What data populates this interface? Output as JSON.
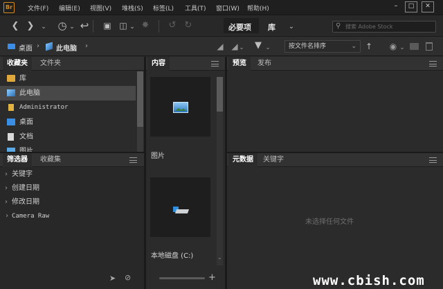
{
  "app": {
    "logo": "Br"
  },
  "menubar": {
    "items": [
      "文件(F)",
      "编辑(E)",
      "视图(V)",
      "堆栈(S)",
      "标签(L)",
      "工具(T)",
      "窗口(W)",
      "帮助(H)"
    ]
  },
  "window": {
    "minimize": "–",
    "maximize": "□",
    "close": "✕"
  },
  "toolbar": {
    "workspaces": [
      "必要项",
      "库"
    ],
    "search_placeholder": "搜索 Adobe Stock"
  },
  "path": {
    "crumbs": [
      "桌面",
      "此电脑"
    ],
    "sort_label": "按文件名排序"
  },
  "favorites_panel": {
    "tabs": [
      "收藏夹",
      "文件夹"
    ],
    "items": [
      {
        "label": "库",
        "icon": "library-icon"
      },
      {
        "label": "此电脑",
        "icon": "computer-icon"
      },
      {
        "label": "Administrator",
        "icon": "user-folder-icon"
      },
      {
        "label": "桌面",
        "icon": "desktop-icon"
      },
      {
        "label": "文档",
        "icon": "document-icon"
      },
      {
        "label": "图片",
        "icon": "pictures-icon"
      }
    ]
  },
  "filter_panel": {
    "tabs": [
      "筛选器",
      "收藏集"
    ],
    "items": [
      "关键字",
      "创建日期",
      "修改日期",
      "Camera Raw"
    ]
  },
  "content_panel": {
    "tab": "内容",
    "items": [
      {
        "label": "图片",
        "icon": "pictures-folder-icon"
      },
      {
        "label": "本地磁盘 (C:)",
        "icon": "drive-icon"
      }
    ]
  },
  "preview_panel": {
    "tabs": [
      "预览",
      "发布"
    ]
  },
  "metadata_panel": {
    "tabs": [
      "元数据",
      "关键字"
    ],
    "empty_text": "未选择任何文件"
  },
  "watermark": "www.cbish.com",
  "colors": {
    "bg": "#282828",
    "panel": "#2b2b2b",
    "tabbar": "#323232",
    "accent": "#d58a1c",
    "folder_blue": "#3a8ee6"
  }
}
